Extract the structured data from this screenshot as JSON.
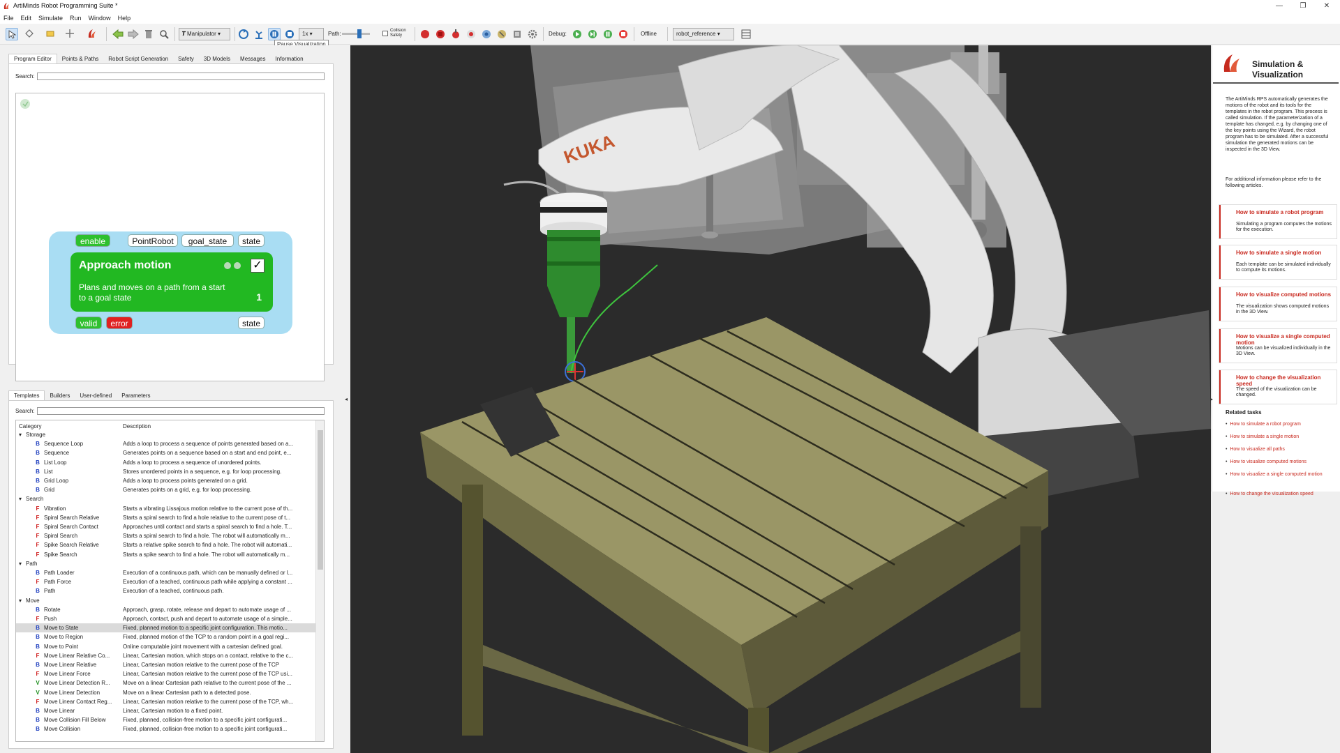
{
  "window": {
    "title": "ArtiMinds Robot Programming Suite *",
    "controls": [
      "—",
      "❐",
      "✕"
    ]
  },
  "menu": [
    "File",
    "Edit",
    "Simulate",
    "Run",
    "Window",
    "Help"
  ],
  "toolbar": {
    "manipulator_label": "Manipulator",
    "speed_value": "1x",
    "path_label": "Path:",
    "collision_label_1": "Collision",
    "collision_label_2": "Safety",
    "debug_label": "Debug:",
    "offline_label": "Offline",
    "robot_combo": "robot_reference",
    "tooltip": "Pause Visualization"
  },
  "top_tabs": [
    "Program Editor",
    "Points & Paths",
    "Robot Script Generation",
    "Safety",
    "3D Models",
    "Messages",
    "Information"
  ],
  "search_label": "Search:",
  "block": {
    "in_params": [
      "enable",
      "PointRobot",
      "goal_state",
      "state"
    ],
    "title": "Approach motion",
    "description": "Plans and moves on a path from a start to a goal state",
    "number": "1",
    "out_params": [
      "valid",
      "error",
      "state"
    ]
  },
  "bottom_tabs": [
    "Templates",
    "Builders",
    "User-defined",
    "Parameters"
  ],
  "list_headers": {
    "category": "Category",
    "description": "Description"
  },
  "template_rows": [
    {
      "type": "group",
      "name": "Storage"
    },
    {
      "type": "item",
      "icon": "B",
      "name": "Sequence Loop",
      "desc": "Adds a loop to process a sequence of points generated based on a..."
    },
    {
      "type": "item",
      "icon": "B",
      "name": "Sequence",
      "desc": "Generates points on a sequence based on a start and end point, e..."
    },
    {
      "type": "item",
      "icon": "B",
      "name": "List Loop",
      "desc": "Adds a loop to process a sequence of unordered points."
    },
    {
      "type": "item",
      "icon": "B",
      "name": "List",
      "desc": "Stores unordered points in a sequence, e.g. for loop processing."
    },
    {
      "type": "item",
      "icon": "B",
      "name": "Grid Loop",
      "desc": "Adds a loop to process points generated on a grid."
    },
    {
      "type": "item",
      "icon": "B",
      "name": "Grid",
      "desc": "Generates points on a grid, e.g. for loop processing."
    },
    {
      "type": "group",
      "name": "Search"
    },
    {
      "type": "item",
      "icon": "F",
      "name": "Vibration",
      "desc": "Starts a vibrating Lissajous motion relative to the current pose of th..."
    },
    {
      "type": "item",
      "icon": "F",
      "name": "Spiral Search Relative",
      "desc": "Starts a spiral search to find a hole relative to the current pose of t..."
    },
    {
      "type": "item",
      "icon": "F",
      "name": "Spiral Search Contact",
      "desc": "Approaches until contact and starts a spiral search to find a hole. T..."
    },
    {
      "type": "item",
      "icon": "F",
      "name": "Spiral Search",
      "desc": "Starts a spiral search to find a hole. The robot will automatically m..."
    },
    {
      "type": "item",
      "icon": "F",
      "name": "Spike Search Relative",
      "desc": "Starts a relative spike search to find a hole. The robot will automati..."
    },
    {
      "type": "item",
      "icon": "F",
      "name": "Spike Search",
      "desc": "Starts a spike search to find a hole. The robot will automatically m..."
    },
    {
      "type": "group",
      "name": "Path"
    },
    {
      "type": "item",
      "icon": "B",
      "name": "Path Loader",
      "desc": "Execution of a continuous path, which can be manually defined or l..."
    },
    {
      "type": "item",
      "icon": "F",
      "name": "Path Force",
      "desc": "Execution of a teached, continuous path while applying a constant ..."
    },
    {
      "type": "item",
      "icon": "B",
      "name": "Path",
      "desc": "Execution of a teached, continuous path."
    },
    {
      "type": "group",
      "name": "Move"
    },
    {
      "type": "item",
      "icon": "B",
      "name": "Rotate",
      "desc": "Approach, grasp, rotate, release and depart to automate usage of ..."
    },
    {
      "type": "item",
      "icon": "F",
      "name": "Push",
      "desc": "Approach, contact, push and depart to automate usage of a simple..."
    },
    {
      "type": "item",
      "icon": "B",
      "name": "Move to State",
      "desc": "Fixed, planned motion to a specific joint configuration. This motio...",
      "selected": true
    },
    {
      "type": "item",
      "icon": "B",
      "name": "Move to Region",
      "desc": "Fixed, planned motion of the TCP to a random point in a goal regi..."
    },
    {
      "type": "item",
      "icon": "B",
      "name": "Move to Point",
      "desc": "Online computable joint movement with a cartesian defined goal."
    },
    {
      "type": "item",
      "icon": "F",
      "name": "Move Linear Relative Co...",
      "desc": "Linear, Cartesian motion, which stops on a contact, relative to the c..."
    },
    {
      "type": "item",
      "icon": "B",
      "name": "Move Linear Relative",
      "desc": "Linear, Cartesian motion relative to the current pose of the TCP"
    },
    {
      "type": "item",
      "icon": "F",
      "name": "Move Linear Force",
      "desc": "Linear, Cartesian motion relative to the current pose of the TCP usi..."
    },
    {
      "type": "item",
      "icon": "V",
      "name": "Move Linear Detection R...",
      "desc": "Move on a linear Cartesian path relative to the current pose of the ..."
    },
    {
      "type": "item",
      "icon": "V",
      "name": "Move Linear Detection",
      "desc": "Move on a linear Cartesian path to a detected pose."
    },
    {
      "type": "item",
      "icon": "F",
      "name": "Move Linear Contact Reg...",
      "desc": "Linear, Cartesian motion relative to the current pose of the TCP, wh..."
    },
    {
      "type": "item",
      "icon": "B",
      "name": "Move Linear",
      "desc": "Linear, Cartesian motion to a fixed point."
    },
    {
      "type": "item",
      "icon": "B",
      "name": "Move Collision Fill Below",
      "desc": "Fixed, planned, collision-free motion to a specific joint configurati..."
    },
    {
      "type": "item",
      "icon": "B",
      "name": "Move Collision",
      "desc": "Fixed, planned, collision-free motion to a specific joint configurati..."
    }
  ],
  "scene": {
    "robot_brand": "KUKA"
  },
  "help": {
    "title_1": "Simulation &",
    "title_2": "Visualization",
    "intro": "The ArtiMinds RPS automatically generates the motions of the robot and its tools for the templates in the robot program. This process is called simulation. If the parameterization of a template has changed, e.g. by changing one of the key points using the Wizard, the robot program has to be simulated. After a successful simulation the generated motions can be inspected in the 3D View.",
    "more": "For additional information please refer to the following articles.",
    "articles": [
      {
        "title": "How to simulate a robot program",
        "text": "Simulating a program computes the motions for the execution."
      },
      {
        "title": "How to simulate a single motion",
        "text": "Each template can be simulated individually to compute its motions."
      },
      {
        "title": "How to visualize computed motions",
        "text": "The visualization shows computed motions in the 3D View."
      },
      {
        "title": "How to visualize a single computed motion",
        "text": "Motions can be visualized individually in the 3D View."
      },
      {
        "title": "How to change the visualization speed",
        "text": "The speed of the visualization can be changed."
      }
    ],
    "related_title": "Related tasks",
    "related": [
      "How to simulate a robot program",
      "How to simulate a single motion",
      "How to visualize all paths",
      "How to visualize computed motions",
      "How to visualize a single computed motion",
      "How to change the visualization speed"
    ]
  },
  "colors": {
    "icon_B": "#1f3fbf",
    "icon_F": "#d02020",
    "icon_V": "#1e8e1e",
    "link": "#c8281e"
  }
}
